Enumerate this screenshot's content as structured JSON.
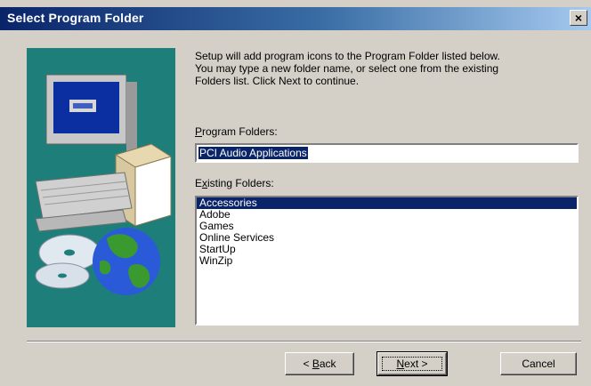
{
  "window": {
    "title": "Select Program Folder",
    "close_glyph": "×"
  },
  "instructions": "Setup will add program icons to the Program Folder listed below.\nYou may type a new folder name, or select one from the existing\nFolders list.  Click Next to continue.",
  "program_folders": {
    "label_accel": "P",
    "label_rest": "rogram Folders:",
    "value": "PCI Audio Applications"
  },
  "existing_folders": {
    "label_pre": "E",
    "label_accel": "x",
    "label_rest": "isting Folders:",
    "items": [
      "Accessories",
      "Adobe",
      "Games",
      "Online Services",
      "StartUp",
      "WinZip"
    ],
    "selected_index": 0
  },
  "buttons": {
    "back_pre": "< ",
    "back_accel": "B",
    "back_rest": "ack",
    "next_accel": "N",
    "next_rest": "ext >",
    "cancel": "Cancel"
  },
  "illustration": {
    "icon_names": [
      "computer-monitor-icon",
      "cd-disc-icon",
      "globe-icon",
      "software-box-icon"
    ],
    "background_color": "#1e7f7a"
  }
}
